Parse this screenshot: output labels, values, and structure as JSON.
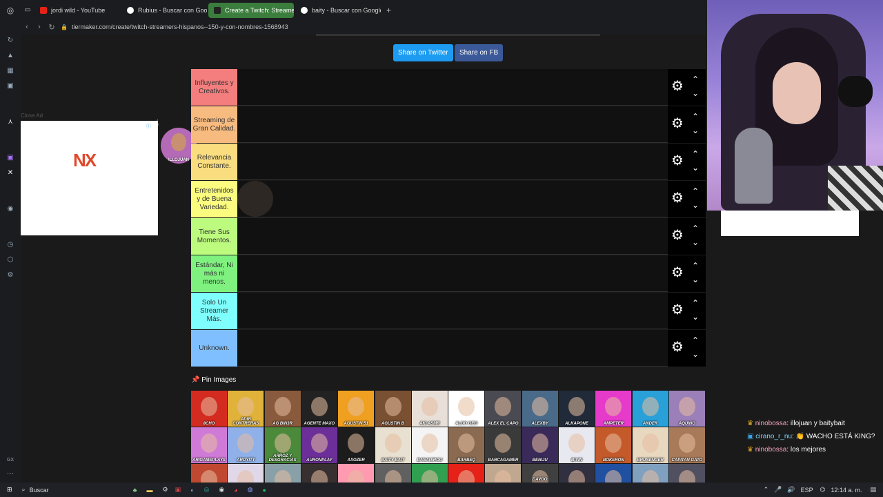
{
  "browser": {
    "tabs": [
      {
        "label": "jordi wild - YouTube",
        "color": "#e62117"
      },
      {
        "label": "Rubius - Buscar con Goo",
        "color": "#ffffff"
      },
      {
        "label": "Create a Twitch: Streame",
        "color": "#ffffff",
        "active": true
      },
      {
        "label": "baity - Buscar con Google",
        "color": "#ffffff"
      }
    ],
    "new_tab": "+",
    "url": "tiermaker.com/create/twitch-streamers-hispanos--150-y-con-nombres-1568943"
  },
  "share": {
    "twitter": "Share on Twitter",
    "fb": "Share on FB"
  },
  "ad": {
    "close_label": "Close Ad",
    "logo": "NX"
  },
  "tiers": [
    {
      "label": "Influyentes y Creativos.",
      "color": "#f47e7e"
    },
    {
      "label": "Streaming de Gran Calidad.",
      "color": "#f8bb7f"
    },
    {
      "label": "Relevancia Constante.",
      "color": "#f9dd7f"
    },
    {
      "label": "Entretenidos y de Buena Variedad.",
      "color": "#fbfc7f"
    },
    {
      "label": "Tiene Sus Momentos.",
      "color": "#bdfb7f"
    },
    {
      "label": "Estándar, Ni más ni menos.",
      "color": "#7ff17f"
    },
    {
      "label": "Solo Un Streamer Más.",
      "color": "#7ffefe"
    },
    {
      "label": "Unknown.",
      "color": "#7fbfff"
    }
  ],
  "dragging": {
    "name": "ILLOJUAN"
  },
  "pin_images": "Pin Images",
  "pool": {
    "row1": [
      "8CHO",
      "ADRI CONTRERAS",
      "AG BIN3R",
      "AGENTE MAXO",
      "AGUSTIN 51",
      "AGUSTIN B",
      "AKI ASMR",
      "ALDO GEO",
      "ALEX EL CAPO",
      "ALEXBY",
      "ALKAPONE",
      "AMPETER",
      "ANDER",
      "AQUINO"
    ],
    "row2": [
      "ARIGAMEPLAYS",
      "AROYITT",
      "ARROZ Y DESGRACIAS",
      "AURONPLAY",
      "AXOZER",
      "BAITY BAIT",
      "BANANIROU",
      "BARBEQ",
      "BARCAGAMER",
      "BENIJU",
      "BIYIN",
      "BOKERON",
      "BRUNENGER",
      "CAPITAN GATO"
    ],
    "row3": [
      "",
      "",
      "",
      "",
      "",
      "",
      "",
      "",
      "",
      "DAVOO",
      "",
      "",
      "",
      ""
    ]
  },
  "pool_colors": {
    "row1": [
      "#d32b1f",
      "#e0b23a",
      "#8a5a3c",
      "#222222",
      "#f0a020",
      "#7a5032",
      "#e8e0d8",
      "#ffffff",
      "#4a4a52",
      "#4a6a8a",
      "#202a38",
      "#e63acb",
      "#2aa0d8",
      "#9b7fb8"
    ],
    "row2": [
      "#d07ad8",
      "#8fb0e8",
      "#4a8a3a",
      "#6c2f9a",
      "#1c1c1c",
      "#e8e0d0",
      "#f4f4f4",
      "#8a6a50",
      "#3a3a3a",
      "#3a2a5a",
      "#e8e8f0",
      "#c45a2a",
      "#e8d8c0",
      "#a87a5a"
    ],
    "row3": [
      "#c04830",
      "#e0d8e8",
      "#8aa0a8",
      "#383030",
      "#ff9ab0",
      "#606060",
      "#30a050",
      "#e62117",
      "#c0a890",
      "#404040",
      "#303040",
      "#2050a0",
      "#80a0c0",
      "#505060"
    ]
  },
  "chat": [
    {
      "user": "ninobossa",
      "text": ": illojuan y baitybait"
    },
    {
      "user": "cirano_r_nu",
      "text": ": 👏 WACHO ESTÁ KING?"
    },
    {
      "user": "ninobossa",
      "text": ": los mejores"
    }
  ],
  "taskbar": {
    "search": "Buscar",
    "lang": "ESP",
    "time": "12:14 a. m."
  }
}
